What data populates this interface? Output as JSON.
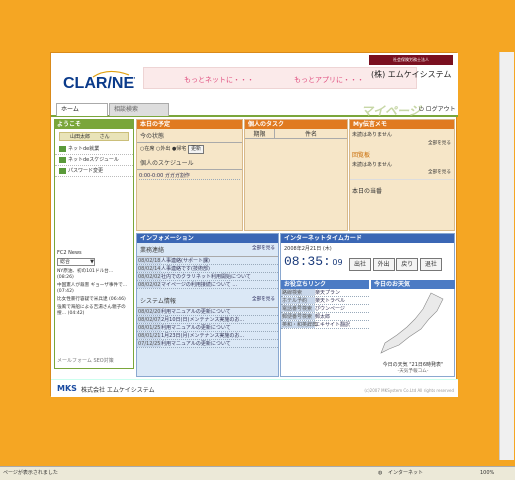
{
  "brand": {
    "logo": "CLAR/NET",
    "logo_sub": "Client Affair Network",
    "logo_tag": "クラリネット",
    "banner_left": "もっとネットに・・・",
    "banner_right": "もっとアプリに・・・",
    "reg_badge": "社会保険労務士法人",
    "company": "(株) エムケイシステム"
  },
  "nav": {
    "tab_home": "ホーム",
    "tab_home_en": "Home",
    "tab_other": "相談検索",
    "mypage": "マイページ",
    "mypage_en": "My Page",
    "logout": "ログアウト",
    "logout_en": "Logout"
  },
  "side": {
    "welcome": "ようこそ",
    "user": "山田太郎",
    "san": "さん",
    "menu": [
      "ネットde就業",
      "ネットdeスケジュール",
      "パスワード変更"
    ],
    "fc2": "FC2 News",
    "fc2_select": "総合",
    "news": [
      "NY原油、初の101ドル台… (08:26)",
      "中国憲人が裁害 ギョーザ事件で… (07:42)",
      "比女性暴行容疑で米兵逮 (06:46)",
      "強風で海船による吉湯さん親子の捜… (04:42)"
    ],
    "mailform": "メールフォーム SEO対策"
  },
  "today": {
    "title": "本日の予定",
    "status_label": "今の状態",
    "radio_in": "在席",
    "radio_out": "外出",
    "radio_away": "帰宅",
    "update": "更新",
    "sched_title": "個人のスケジュール",
    "sched_item_time": "0:00-0:00",
    "sched_item": "ガガガ割作"
  },
  "tasks": {
    "title": "個人のタスク",
    "col_due": "期限",
    "col_name": "件名"
  },
  "memo": {
    "title": "My伝言メモ",
    "memo_text": "未読はありません",
    "see_all": "全部を見る",
    "notice_title": "回覧板",
    "notice_text": "未読はありません",
    "duty_title": "本日の当番"
  },
  "info": {
    "title": "インフォメーション",
    "biz_title": "業務連絡",
    "see_all": "全部を見る",
    "biz": [
      {
        "date": "08/02/18",
        "text": "人事連絡(サポート課)"
      },
      {
        "date": "08/02/14",
        "text": "人事連絡です(技術部)"
      },
      {
        "date": "08/02/02",
        "text": "社内でのクラリネット利用開始について"
      },
      {
        "date": "08/02/02",
        "text": "マイページの利用接続について ..."
      }
    ],
    "sys_title": "システム情報",
    "sys": [
      {
        "date": "08/02/20",
        "text": "利用マニュアルの更新について"
      },
      {
        "date": "08/02/07",
        "text": "2月10日(日)メンテナンス実施のお..."
      },
      {
        "date": "08/01/25",
        "text": "利用マニュアルの更新について"
      },
      {
        "date": "08/01/21",
        "text": "1月23日(月)メンテナンス実施のお..."
      },
      {
        "date": "07/12/25",
        "text": "利用マニュアルの更新について"
      }
    ]
  },
  "time": {
    "title": "インターネットタイムカード",
    "date": "2008年2月21日 (木)",
    "clock": "08:35:",
    "sec": "09",
    "btn_in": "出社",
    "btn_out": "外出",
    "btn_back": "戻り",
    "btn_leave": "退社"
  },
  "links": {
    "title": "お役立ちリンク",
    "items": [
      [
        "路線検索",
        "楽天プラン"
      ],
      [
        "ホテル予約",
        "楽天トラベル"
      ],
      [
        "電話番号検索",
        "ぴウンページ"
      ],
      [
        "郵便番号検索",
        "郵太郎"
      ],
      [
        "英和・和英辞典",
        "エキサイト翻訳"
      ]
    ]
  },
  "weather": {
    "title": "今日のお天気",
    "note": "今日の天気 \"21日6時発表\"",
    "source": "-天気予報コム-"
  },
  "footer": {
    "company": "株式会社 エムケイシステム",
    "copy": "(c)2007 MKSystem Co.Ltd All rights reserved"
  },
  "status": {
    "text": "ページが表示されました",
    "zone": "インターネット",
    "zoom": "100%"
  }
}
